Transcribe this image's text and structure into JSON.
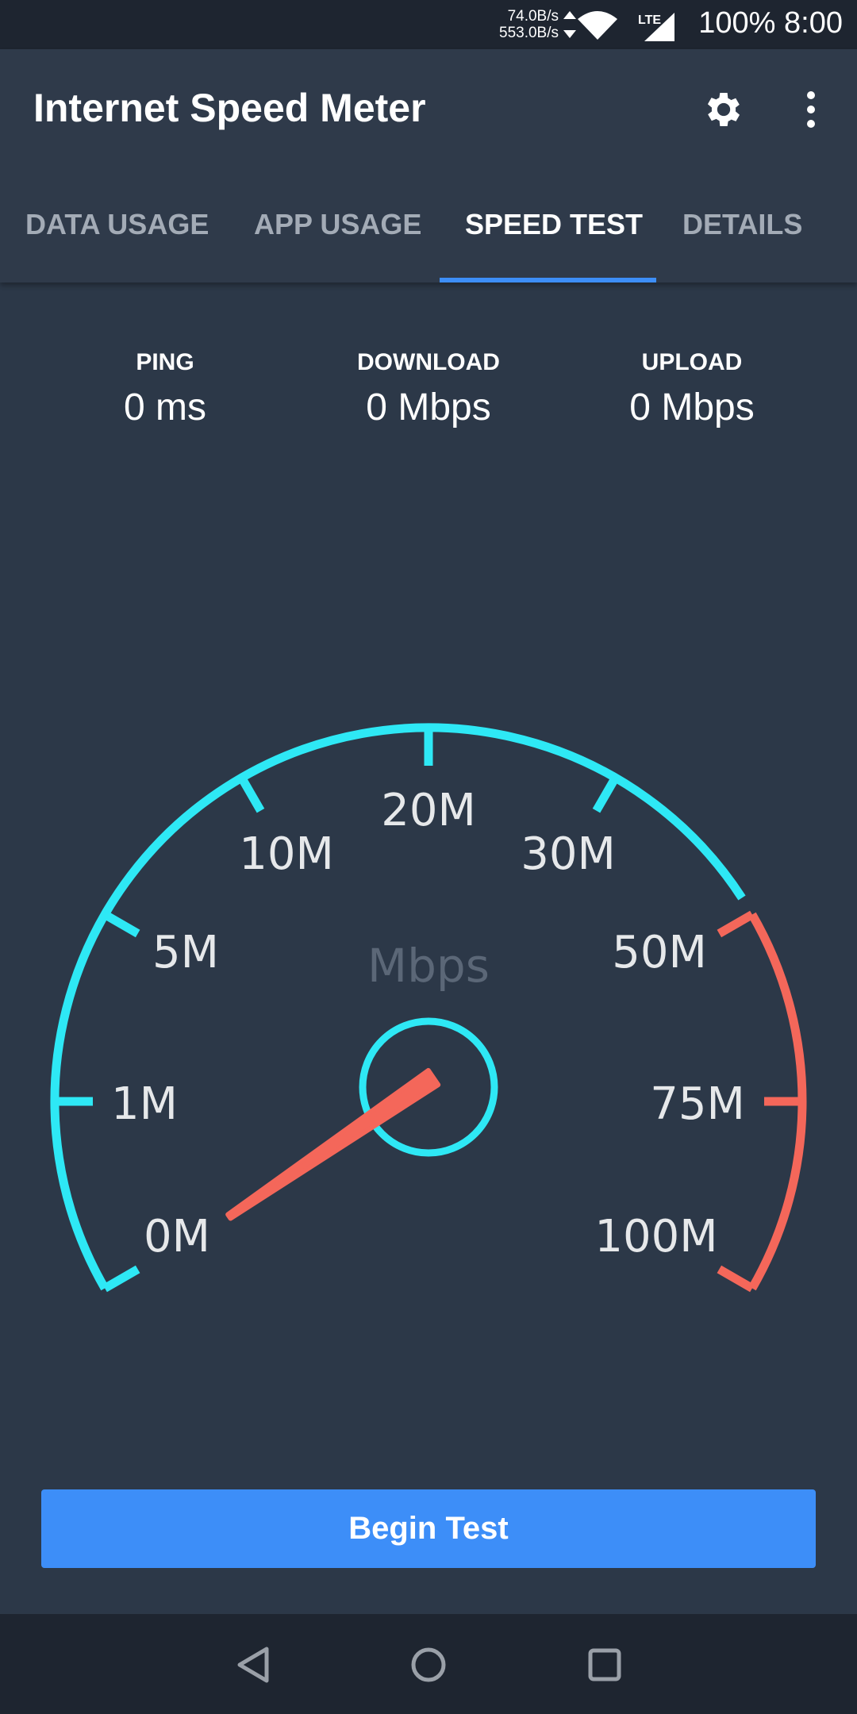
{
  "status_bar": {
    "upload_rate": "74.0B/s",
    "download_rate": "553.0B/s",
    "network": "LTE",
    "battery": "100%",
    "time": "8:00"
  },
  "app_bar": {
    "title": "Internet Speed Meter",
    "settings_icon": "gear-icon",
    "more_icon": "more-vert-icon"
  },
  "tabs": [
    {
      "label": "DATA USAGE"
    },
    {
      "label": "APP USAGE"
    },
    {
      "label": "SPEED TEST",
      "active": true
    },
    {
      "label": "DETAILS"
    }
  ],
  "stats": {
    "ping": {
      "label": "PING",
      "value": "0 ms"
    },
    "download": {
      "label": "DOWNLOAD",
      "value": "0 Mbps"
    },
    "upload": {
      "label": "UPLOAD",
      "value": "0 Mbps"
    }
  },
  "gauge": {
    "unit": "Mbps",
    "ticks": [
      "0M",
      "1M",
      "5M",
      "10M",
      "20M",
      "30M",
      "50M",
      "75M",
      "100M"
    ],
    "current_value": 0,
    "colors": {
      "normal": "#2ee8f5",
      "high": "#f4675a",
      "needle": "#f4675a"
    }
  },
  "begin_button": "Begin Test",
  "nav": {
    "back": "back-icon",
    "home": "home-icon",
    "recents": "recents-icon"
  }
}
